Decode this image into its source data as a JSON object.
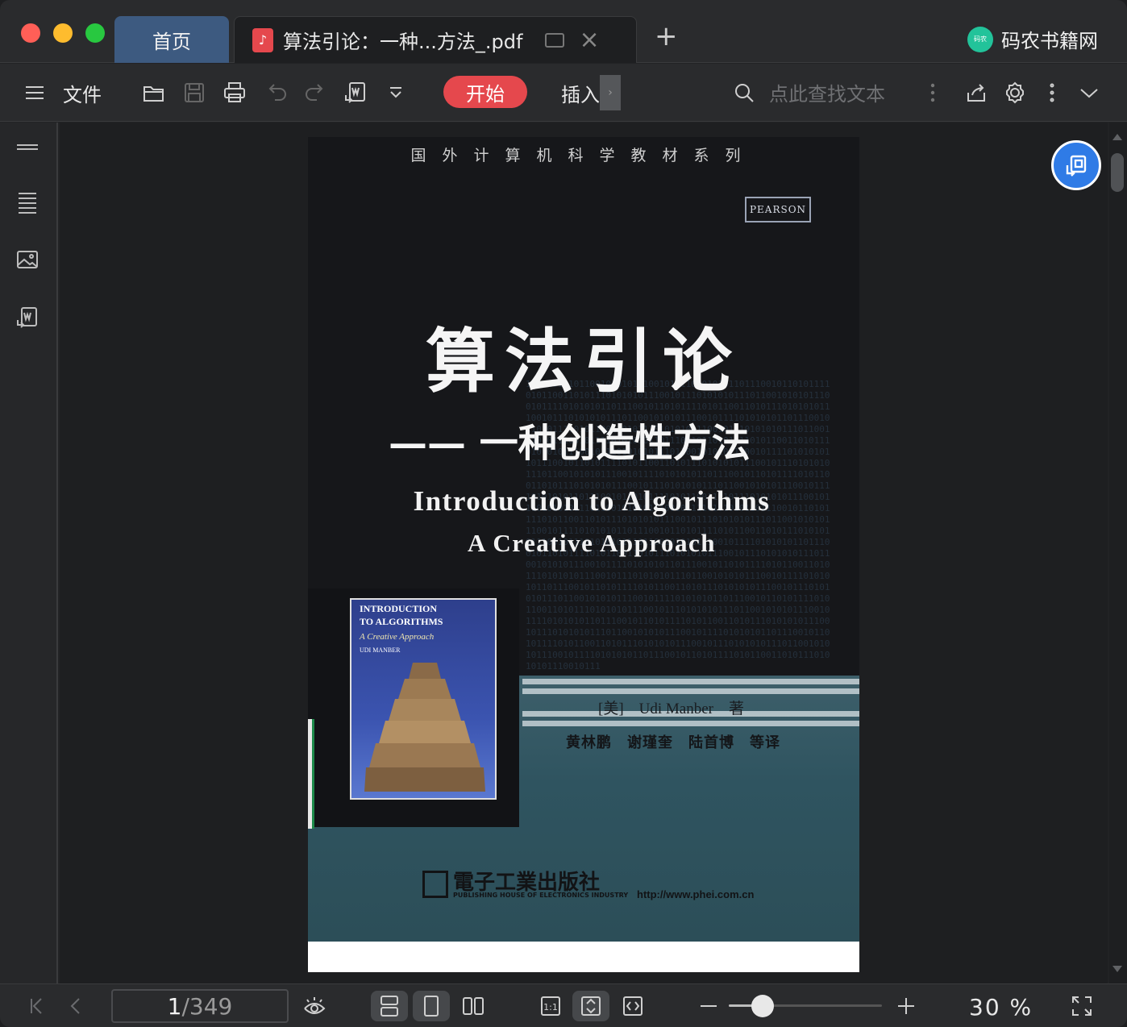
{
  "titlebar": {
    "home_tab": "首页",
    "doc_tab_title": "算法引论：一种...方法_.pdf",
    "brand_name": "码农书籍网",
    "brand_logo_text": "码农"
  },
  "toolbar": {
    "file_label": "文件",
    "start_label": "开始",
    "insert_label": "插入",
    "search_placeholder": "点此查找文本",
    "accent_color": "#e5484d"
  },
  "page_content": {
    "series": "国外计算机科学教材系列",
    "publisher_logo": "PEARSON",
    "cn_title": "算法引论",
    "cn_subtitle": "—— 一种创造性方法",
    "en_title": "Introduction to Algorithms",
    "en_subtitle": "A Creative Approach",
    "book_cover_line1": "INTRODUCTION",
    "book_cover_line2": "TO ALGORITHMS",
    "book_cover_line3": "A Creative Approach",
    "book_cover_author": "UDI MANBER",
    "author_line": "[美]　Udi Manber　著",
    "translators_line": "黄林鹏　谢瑾奎　陆首博　等译",
    "publisher_cn": "電子工業出版社",
    "publisher_en": "PUBLISHING HOUSE OF ELECTRONICS INDUSTRY",
    "url": "http://www.phei.com.cn",
    "binary": "10101011101100101010111001011110101010110111001011010111101011001101011101010101110010111010101011101100101010111001011110101010110111001011010111101011001101011101010101110010111010101011101100101010111001011110101010110111001011010111101011001101011101010101110010111010101011101100101010111001011110101010110111001011010111101011001101011101010101110010111010101011101100101010111001011110101010110111001011010111101011001101011101010101110010111010101011101100101010111001011110101010110111001011010111101011001101011101010101110010111010101011101100101010111001011110101010110111001011010111101011001101011101010101110010111010101011101100101010111001011110101010110111001011010111101011001101011101010101110010111010101011101100101010111001011110101010110111001011010111101011001101011101010101110010111010101011101100101010111001011110101010110111001011010111101011001101011101010101110010111010101011101100101010111001011110101010110111001011010111101011001101011101010101110010111010101011101100101010111001011110101010110111001011010111101011001101011101010101110010111010101011101100101010111001011110101010110111001011010111101011001101011101010101110010111010101011101100101010111001011110101010110111001011010111101011001101011101010101110010111010101011101100101010111001011110101010110111001011010111101011001101011101010101110010111010101011101100101010111001011110101010110111001011010111101011001101011101010101110010111"
  },
  "bottombar": {
    "current_page": "1",
    "total_pages": "/349",
    "zoom_label": "30 %",
    "zoom_fraction": 0.22
  }
}
